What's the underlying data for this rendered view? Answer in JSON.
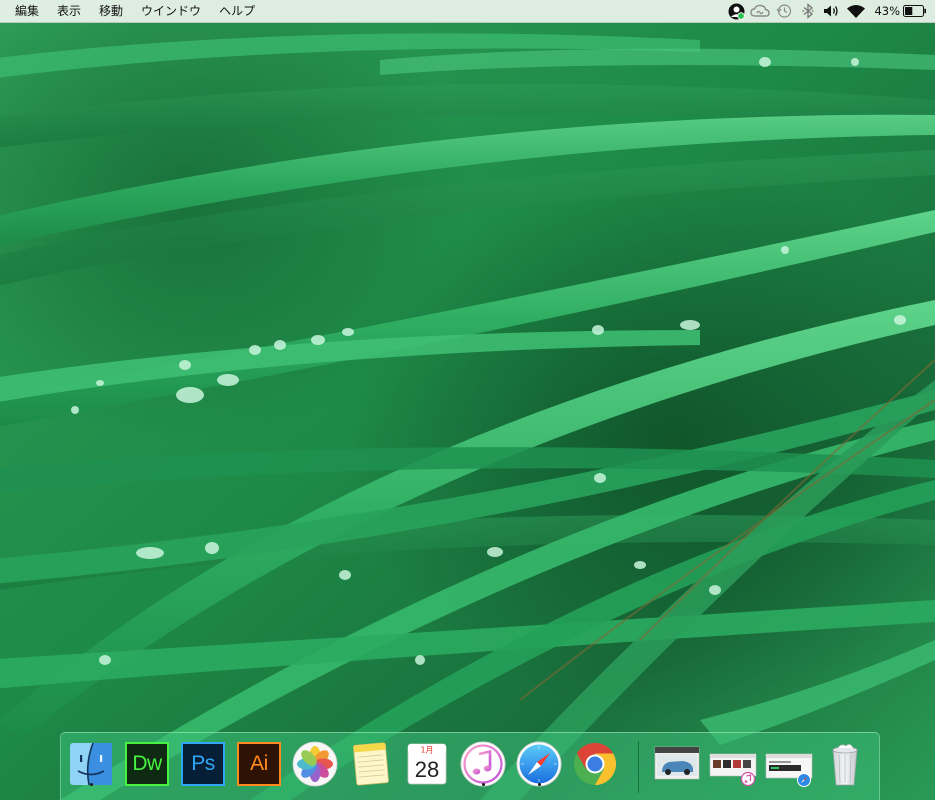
{
  "menubar": {
    "menus": [
      {
        "label": "編集"
      },
      {
        "label": "表示"
      },
      {
        "label": "移動"
      },
      {
        "label": "ウインドウ"
      },
      {
        "label": "ヘルプ"
      }
    ],
    "status_icons": [
      "user-account-icon",
      "creative-cloud-icon",
      "time-machine-icon",
      "bluetooth-icon",
      "volume-icon",
      "wifi-icon"
    ],
    "battery": {
      "percent_label": "43%",
      "level": 0.43
    }
  },
  "dock": {
    "apps": [
      {
        "name": "finder-icon",
        "running": true
      },
      {
        "name": "dreamweaver-icon",
        "label": "Dw",
        "color": "#46f13f",
        "bg": "#0f2a12",
        "running": false
      },
      {
        "name": "photoshop-icon",
        "label": "Ps",
        "color": "#30a6f6",
        "bg": "#061e36",
        "running": false
      },
      {
        "name": "illustrator-icon",
        "label": "Ai",
        "color": "#ff8a1d",
        "bg": "#2e1203",
        "running": false
      },
      {
        "name": "photos-icon",
        "running": false
      },
      {
        "name": "notes-icon",
        "running": false
      },
      {
        "name": "calendar-icon",
        "month": "1月",
        "day": "28",
        "running": false
      },
      {
        "name": "itunes-icon",
        "running": true
      },
      {
        "name": "safari-icon",
        "running": true
      },
      {
        "name": "chrome-icon",
        "running": false
      }
    ],
    "minimized": [
      {
        "name": "minimized-window-car-photo"
      },
      {
        "name": "minimized-window-itunes"
      },
      {
        "name": "minimized-window-safari"
      }
    ],
    "trash": {
      "name": "trash-icon"
    }
  },
  "wallpaper": {
    "name": "grass-wallpaper",
    "base_color": "#1f7a3e"
  }
}
